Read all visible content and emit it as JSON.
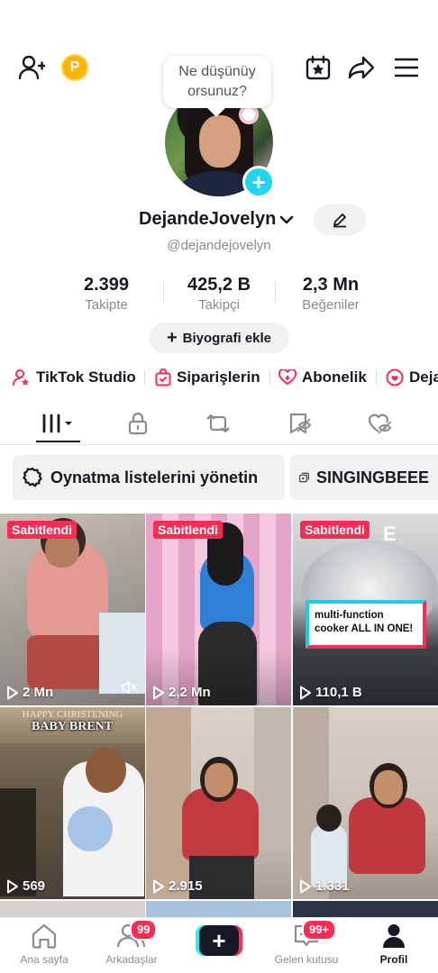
{
  "top_bar": {
    "coin_letter": "P"
  },
  "bubble": {
    "line1": "Ne düşünüy",
    "line2": "orsunuz?"
  },
  "profile": {
    "display_name": "DejandeJovelyn",
    "handle": "@dejandejovelyn",
    "stats": [
      {
        "value": "2.399",
        "label": "Takipte"
      },
      {
        "value": "425,2 B",
        "label": "Takipçi"
      },
      {
        "value": "2,3 Mn",
        "label": "Beğeniler"
      }
    ],
    "bio_button": "Biyografi ekle"
  },
  "quick_links": [
    {
      "label": "TikTok Studio",
      "icon": "person-star-icon"
    },
    {
      "label": "Siparişlerin",
      "icon": "shopping-bag-icon"
    },
    {
      "label": "Abonelik",
      "icon": "heart-plus-icon"
    },
    {
      "label": "Deja",
      "icon": "smile-heart-icon"
    }
  ],
  "tabs": [
    "videos-grid-icon",
    "lock-icon",
    "repost-icon",
    "favorites-icon",
    "liked-icon"
  ],
  "chips": [
    {
      "label": "Oynatma listelerini yönetin",
      "icon": "gear-icon"
    },
    {
      "label": "SINGINGBEEE",
      "icon": "playlist-icon"
    }
  ],
  "videos": [
    {
      "pinned": "Sabitlendi",
      "views": "2 Mn",
      "muted": true
    },
    {
      "pinned": "Sabitlendi",
      "views": "2,2 Mn"
    },
    {
      "pinned": "Sabitlendi",
      "views": "110,1 B",
      "overlay_text": "multi-function cooker ALL IN ONE!",
      "corner_letter": "E"
    },
    {
      "views": "569",
      "overlay_line1": "HAPPY CHRISTENING",
      "overlay_line2": "BABY BRENT"
    },
    {
      "views": "2.915"
    },
    {
      "views": "1.331"
    }
  ],
  "bottom_nav": {
    "home": "Ana sayfa",
    "friends": "Arkadaşlar",
    "friends_badge": "99",
    "inbox": "Gelen kutusu",
    "inbox_badge": "99+",
    "profile": "Profil"
  },
  "colors": {
    "accent_red": "#fe2c55",
    "accent_cyan": "#25f4ee",
    "plus_badge": "#20d5ec",
    "coin": "#ffb400"
  }
}
